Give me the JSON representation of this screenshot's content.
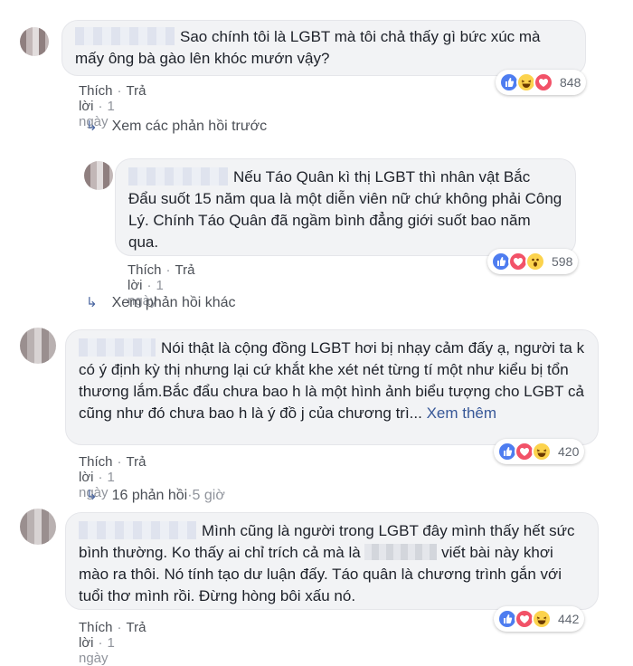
{
  "comments": [
    {
      "text": "Sao chính tôi là LGBT mà tôi chả thấy gì bức xúc mà mấy ông bà gào lên khóc mướn vậy?",
      "like": "Thích",
      "reply": "Trả lời",
      "time": "1 ngày",
      "reaction_count": "848"
    },
    {
      "text": "Nếu Táo Quân kì thị LGBT thì nhân vật Bắc Đẩu suốt 15 năm qua là một diễn viên nữ chứ không phải Công Lý. Chính Táo Quân đã ngầm bình đẳng giới suốt bao năm qua.",
      "like": "Thích",
      "reply": "Trả lời",
      "time": "1 ngày",
      "reaction_count": "598"
    },
    {
      "text_1": "Nói thật là cộng đồng LGBT hơi bị nhạy cảm đấy ạ, người ta k có ý định kỳ thị nhưng lại cứ khắt khe xét nét từng tí một như kiểu bị tổn thương lắm.Bắc đẩu chưa bao h là một hình ảnh biểu tượng cho LGBT cả cũng như đó chưa bao h là ý đồ j của chương trì...",
      "see_more": "Xem thêm",
      "like": "Thích",
      "reply": "Trả lời",
      "time": "1 ngày",
      "reaction_count": "420"
    },
    {
      "text_a": "Mình cũng là người trong LGBT đây mình thấy hết sức bình thường. Ko thấy ai chỉ trích cả mà là",
      "text_b": "viết bài này khơi mào ra thôi. Nó tính tạo dư luận đấy. Táo quân là chương trình gắn với tuổi thơ mình rồi. Đừng hòng bôi xấu nó.",
      "like": "Thích",
      "reply": "Trả lời",
      "time": "1 ngày",
      "reaction_count": "442"
    }
  ],
  "reply_links": {
    "previous": "Xem các phản hồi trước",
    "other": "Xem phản hồi khác",
    "replies_count": "16 phản hồi",
    "replies_time": "5 giờ"
  },
  "separator": "·",
  "colors": {
    "like_blue": "#4e7df0",
    "haha_yellow": "#fcd34d",
    "love_red": "#f25268",
    "link": "#385898"
  },
  "icons": [
    "like-icon",
    "haha-icon",
    "love-icon",
    "wow-icon",
    "reply-arrow-icon"
  ]
}
